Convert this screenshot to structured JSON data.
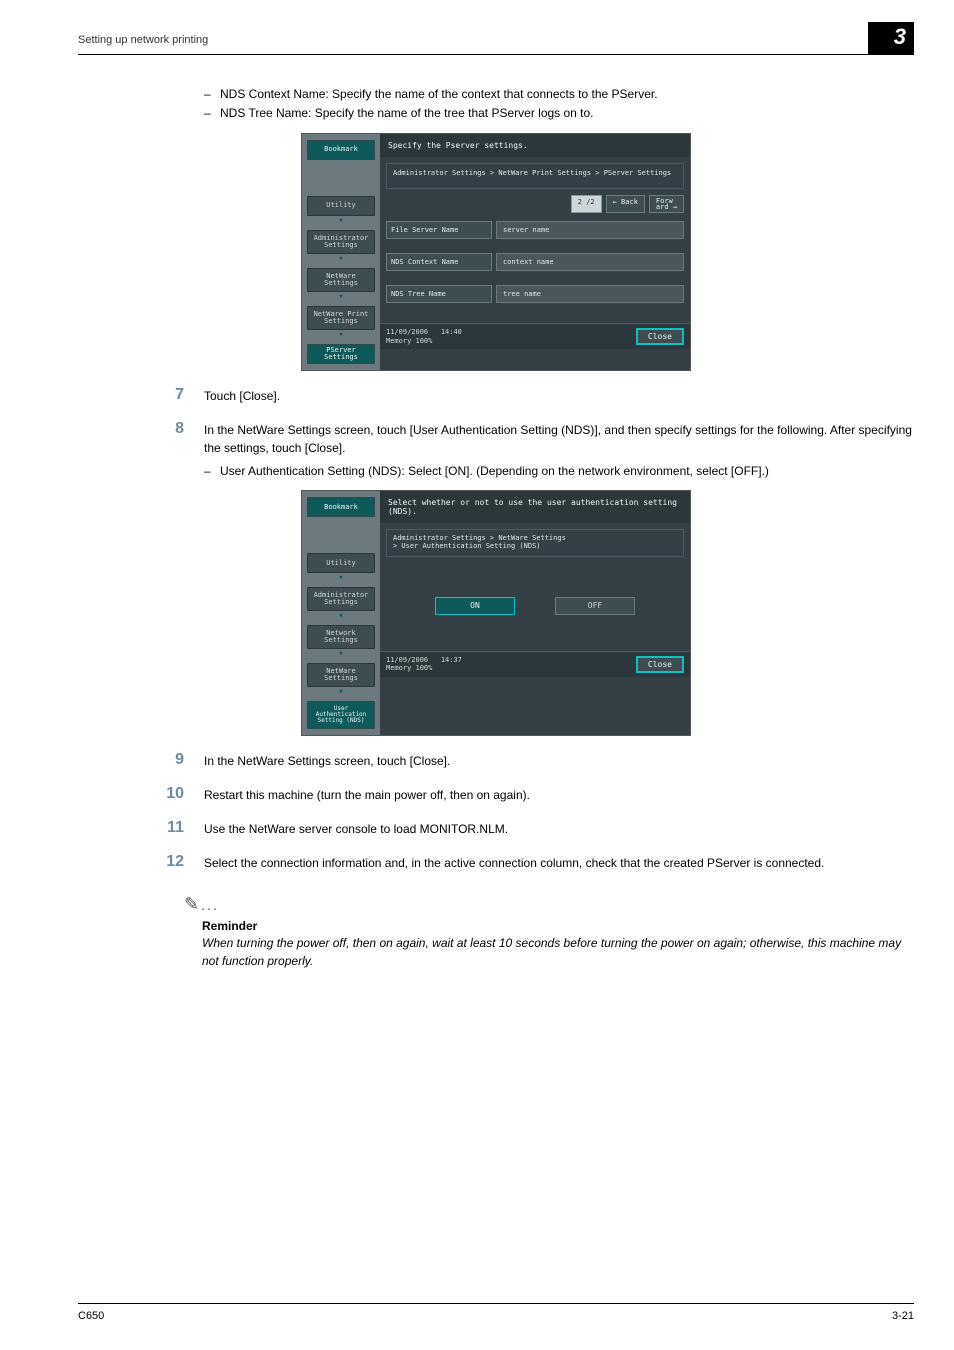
{
  "header": {
    "running": "Setting up network printing",
    "chapter": "3"
  },
  "intro_bullets": [
    "NDS Context Name: Specify the name of the context that connects to the PServer.",
    "NDS Tree Name: Specify the name of the tree that PServer logs on to."
  ],
  "shot1": {
    "title": "Specify the Pserver settings.",
    "crumb": "Administrator Settings > NetWare Print Settings > PServer Settings",
    "pager": {
      "page": "2 /2",
      "back": "← Back",
      "fwd": "Forw\nard →"
    },
    "side": {
      "bookmark": "Bookmark",
      "items": [
        "Utility",
        "Administrator\nSettings",
        "NetWare\nSettings",
        "NetWare Print\nSettings",
        "PServer Settings"
      ]
    },
    "fields": [
      {
        "label": "File Server Name",
        "value": "server name"
      },
      {
        "label": "NDS Context Name",
        "value": "context name"
      },
      {
        "label": "NDS Tree Name",
        "value": "tree name"
      }
    ],
    "footer": {
      "date": "11/09/2006",
      "time": "14:40",
      "mem": "Memory   100%",
      "close": "Close"
    }
  },
  "steps": {
    "s7": "Touch [Close].",
    "s8a": "In the NetWare Settings screen, touch [User Authentication Setting (NDS)], and then specify settings for the following. After specifying the settings, touch [Close].",
    "s8b": "User Authentication Setting (NDS): Select [ON]. (Depending on the network environment, select [OFF].)",
    "s9": "In the NetWare Settings screen, touch [Close].",
    "s10": "Restart this machine (turn the main power off, then on again).",
    "s11": "Use the NetWare server console to load MONITOR.NLM.",
    "s12": "Select the connection information and, in the active connection column, check that the created PServer is connected."
  },
  "shot2": {
    "title": "Select whether or not to use the user authentication setting (NDS).",
    "crumb": "Administrator Settings > NetWare Settings\n> User Authentication Setting (NDS)",
    "side": {
      "bookmark": "Bookmark",
      "items": [
        "Utility",
        "Administrator\nSettings",
        "Network\nSettings",
        "NetWare\nSettings",
        "User\nAuthentication\nSetting (NDS)"
      ]
    },
    "on": "ON",
    "off": "OFF",
    "footer": {
      "date": "11/09/2006",
      "time": "14:37",
      "mem": "Memory   100%",
      "close": "Close"
    }
  },
  "reminder": {
    "heading": "Reminder",
    "text": "When turning the power off, then on again, wait at least 10 seconds before turning the power on again; otherwise, this machine may not function properly."
  },
  "footer": {
    "left": "C650",
    "right": "3-21"
  }
}
